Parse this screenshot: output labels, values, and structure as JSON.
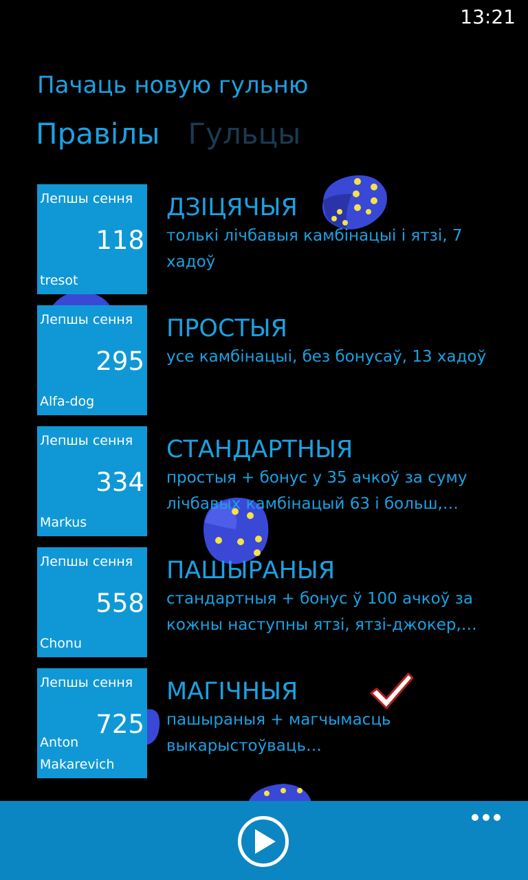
{
  "status": {
    "time": "13:21"
  },
  "app_title": "Пачаць новую гульню",
  "tabs": [
    {
      "label": "Правілы",
      "active": true
    },
    {
      "label": "Гульцы",
      "active": false
    }
  ],
  "modes": [
    {
      "title": "ДЗІЦЯЧЫЯ",
      "desc": "толькі лічбавыя камбінацыі і ятзі, 7 хадоў",
      "tile": {
        "label": "Лепшы сення",
        "score": "118",
        "player": "tresot"
      }
    },
    {
      "title": "ПРОСТЫЯ",
      "desc": "усе камбінацыі, без бонусаў, 13 хадоў",
      "tile": {
        "label": "Лепшы сення",
        "score": "295",
        "player": "Alfa-dog"
      }
    },
    {
      "title": "СТАНДАРТНЫЯ",
      "desc": "простыя + бонус у 35 ачкоў за суму лічбавых камбінацый 63 і больш,…",
      "tile": {
        "label": "Лепшы сення",
        "score": "334",
        "player": "Markus"
      }
    },
    {
      "title": "ПАШЫРАНЫЯ",
      "desc": "стандартныя + бонус ў 100 ачкоў за кожны наступны ятзі, ятзі-джокер,…",
      "tile": {
        "label": "Лепшы сення",
        "score": "558",
        "player": "Chonu"
      }
    },
    {
      "title": "МАГІЧНЫЯ",
      "desc": "пашыраныя + магчымасць выкарыстоўваць…",
      "tile": {
        "label": "Лепшы сення",
        "score": "725",
        "player": "Anton Makarevich"
      },
      "selected": true
    }
  ],
  "app_bar": {
    "play_icon": "play-icon",
    "more_icon": "more-icon"
  },
  "colors": {
    "accent": "#1ba1e2",
    "tile": "#1098d6",
    "app_bar": "#0c86c2",
    "dice": "#3a48d6",
    "pip": "#f5e24a"
  }
}
